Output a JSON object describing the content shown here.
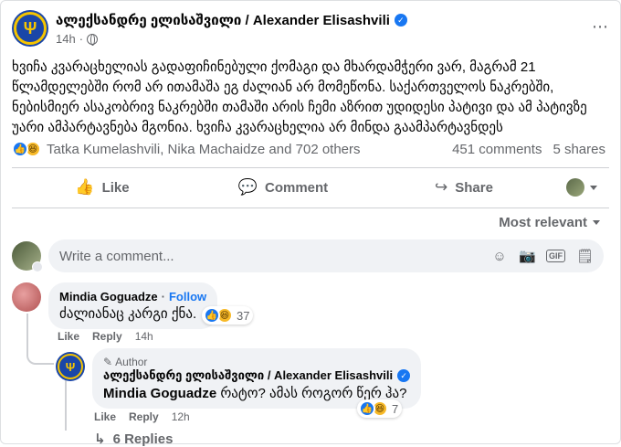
{
  "post": {
    "author": "ალექსანდრე ელისაშვილი / Alexander Elisashvili",
    "time": "14h",
    "text": "ხვიჩა კვარაცხელიას გადაფიჩინებული ქომაგი და მხარდამჭერი ვარ, მაგრამ 21 წლამდელებში რომ არ ითამაშა ეგ ძალიან არ მომეწონა. საქართველოს ნაკრებში, ნებისმიერ ასაკობრივ ნაკრებში თამაში არის ჩემი აზრით უდიდესი პატივი და ამ პატივზე უარი ამპარტავნება მგონია. ხვიჩა კვარაცხელია არ მინდა გაამპარტავნდეს",
    "reactors": "Tatka Kumelashvili, Nika Machaidze and 702 others",
    "comments_count": "451 comments",
    "shares_count": "5 shares"
  },
  "actions": {
    "like": "Like",
    "comment": "Comment",
    "share": "Share"
  },
  "sort_label": "Most relevant",
  "write_placeholder": "Write a comment...",
  "comments": [
    {
      "name": "Mindia Goguadze",
      "follow": "Follow",
      "text": "ძალიანაც კარგი ქნა.",
      "reactions": "37",
      "like": "Like",
      "reply": "Reply",
      "time": "14h"
    }
  ],
  "reply": {
    "tag": "Author",
    "name": "ალექსანდრე ელისაშვილი / Alexander Elisashvili",
    "mention": "Mindia Goguadze",
    "text": "რატო? ამას როგორ წერ ჰა?",
    "reactions": "7",
    "like": "Like",
    "reply": "Reply",
    "time": "12h"
  },
  "replies_link": "6 Replies",
  "separator_dot": "·",
  "icons": {
    "more": "⋯",
    "like_reaction": "👍",
    "haha_reaction": "😆",
    "verified": "✓",
    "like_action": "👍",
    "comment_action": "💬",
    "share_action": "↪",
    "emoji": "☺",
    "camera": "📷",
    "gif": "GIF",
    "sticker": "🗒",
    "author_tag": "✎",
    "reply_arrow": "↳",
    "trident": "Ψ"
  }
}
